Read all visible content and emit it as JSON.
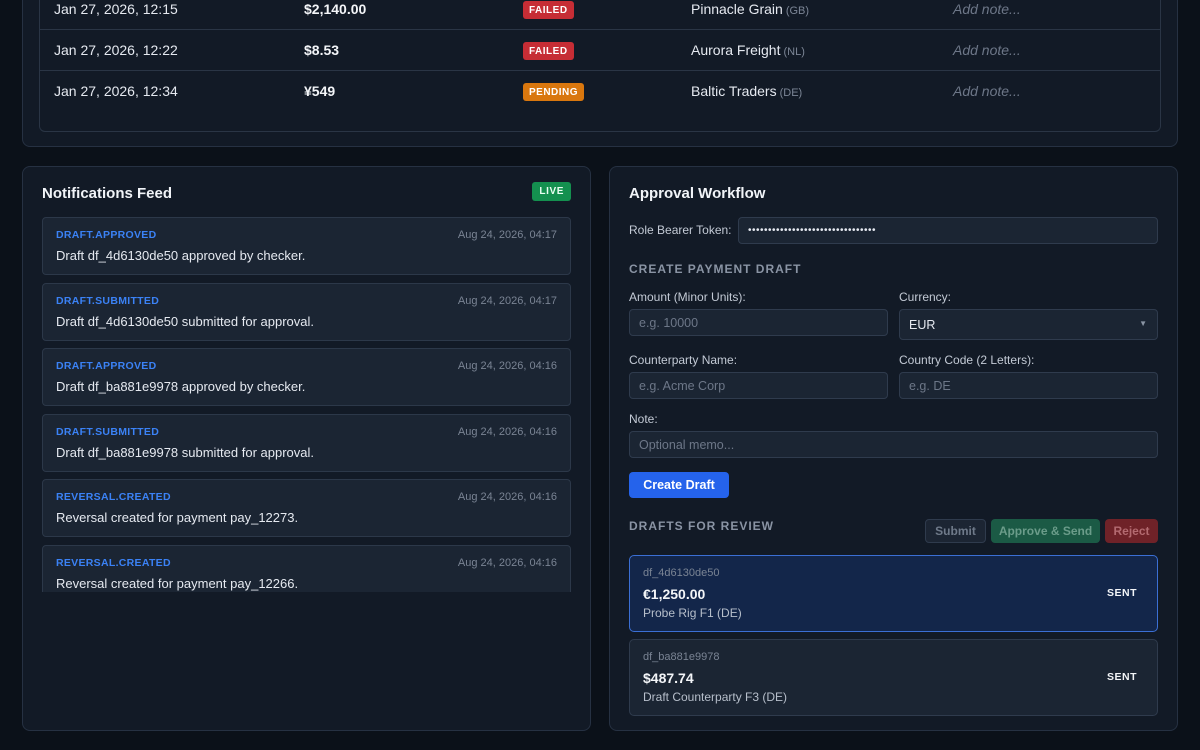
{
  "transactions": [
    {
      "date": "Jan 27, 2026, 12:15",
      "amount": "$2,140.00",
      "status": "FAILED",
      "status_kind": "failed",
      "counterparty": "Pinnacle Grain",
      "country": "(GB)",
      "note": "Add note..."
    },
    {
      "date": "Jan 27, 2026, 12:22",
      "amount": "$8.53",
      "status": "FAILED",
      "status_kind": "failed",
      "counterparty": "Aurora Freight",
      "country": "(NL)",
      "note": "Add note..."
    },
    {
      "date": "Jan 27, 2026, 12:34",
      "amount": "¥549",
      "status": "PENDING",
      "status_kind": "pending",
      "counterparty": "Baltic Traders",
      "country": "(DE)",
      "note": "Add note..."
    }
  ],
  "notifications": {
    "title": "Notifications Feed",
    "live_label": "LIVE",
    "items": [
      {
        "event": "DRAFT.APPROVED",
        "time": "Aug 24, 2026, 04:17",
        "message": "Draft df_4d6130de50 approved by checker."
      },
      {
        "event": "DRAFT.SUBMITTED",
        "time": "Aug 24, 2026, 04:17",
        "message": "Draft df_4d6130de50 submitted for approval."
      },
      {
        "event": "DRAFT.APPROVED",
        "time": "Aug 24, 2026, 04:16",
        "message": "Draft df_ba881e9978 approved by checker."
      },
      {
        "event": "DRAFT.SUBMITTED",
        "time": "Aug 24, 2026, 04:16",
        "message": "Draft df_ba881e9978 submitted for approval."
      },
      {
        "event": "REVERSAL.CREATED",
        "time": "Aug 24, 2026, 04:16",
        "message": "Reversal created for payment pay_12273."
      },
      {
        "event": "REVERSAL.CREATED",
        "time": "Aug 24, 2026, 04:16",
        "message": "Reversal created for payment pay_12266."
      }
    ]
  },
  "approval": {
    "title": "Approval Workflow",
    "token_label": "Role Bearer Token:",
    "token_value": "••••••••••••••••••••••••••••••••",
    "create_heading": "CREATE PAYMENT DRAFT",
    "amount_label": "Amount (Minor Units):",
    "amount_placeholder": "e.g. 10000",
    "currency_label": "Currency:",
    "currency_value": "EUR",
    "counterparty_label": "Counterparty Name:",
    "counterparty_placeholder": "e.g. Acme Corp",
    "country_label": "Country Code (2 Letters):",
    "country_placeholder": "e.g. DE",
    "note_label": "Note:",
    "note_placeholder": "Optional memo...",
    "create_button": "Create Draft",
    "review_heading": "DRAFTS FOR REVIEW",
    "submit_button": "Submit",
    "approve_button": "Approve & Send",
    "reject_button": "Reject",
    "drafts": [
      {
        "id": "df_4d6130de50",
        "amount": "€1,250.00",
        "counterparty": "Probe Rig F1 (DE)",
        "status": "SENT"
      },
      {
        "id": "df_ba881e9978",
        "amount": "$487.74",
        "counterparty": "Draft Counterparty F3 (DE)",
        "status": "SENT"
      }
    ]
  },
  "colors": {
    "accent": "#2563eb",
    "failed": "#c62d35",
    "pending": "#d9770e",
    "live": "#14904f",
    "event_label": "#3b82f6"
  }
}
